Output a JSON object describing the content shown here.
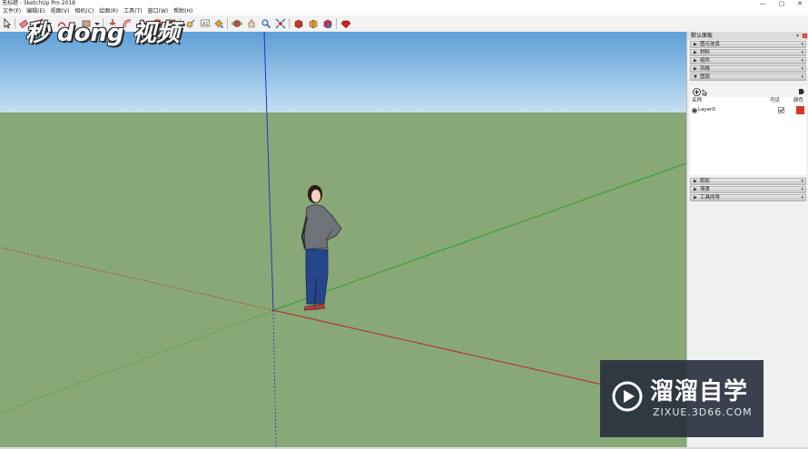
{
  "window": {
    "title": "无标题 - SketchUp Pro 2018",
    "minimize": "—",
    "maximize": "▢",
    "close": "✕"
  },
  "menu": [
    "文件(F)",
    "编辑(E)",
    "视图(V)",
    "相机(C)",
    "绘图(R)",
    "工具(T)",
    "窗口(W)",
    "帮助(H)"
  ],
  "toolbar": {
    "tools": [
      "select-tool",
      "eraser-tool",
      "line-tool",
      "arc-tool",
      "rectangle-tool",
      "push-pull-tool",
      "move-tool",
      "rotate-tool",
      "scale-tool",
      "offset-tool",
      "tape-measure-tool",
      "text-tool",
      "paint-bucket-tool",
      "orbit-tool",
      "pan-tool",
      "zoom-tool",
      "zoom-extents-tool",
      "warehouse-tool",
      "extension-tool",
      "component-tool",
      "ruby-tool"
    ]
  },
  "tray": {
    "title": "默认面板",
    "pin": "▾",
    "close": "✕",
    "panels_top": [
      {
        "label": "图元信息",
        "expanded": false
      },
      {
        "label": "材料",
        "expanded": false
      },
      {
        "label": "组件",
        "expanded": false
      },
      {
        "label": "风格",
        "expanded": false
      },
      {
        "label": "图层",
        "expanded": true
      }
    ],
    "layers": {
      "col_name": "名称",
      "col_visible": "可见",
      "col_color": "颜色",
      "rows": [
        {
          "name": "Layer0",
          "active": true,
          "visible": true,
          "color": "#d9362b"
        }
      ]
    },
    "panels_bottom": [
      {
        "label": "阴影"
      },
      {
        "label": "场景"
      },
      {
        "label": "工具向导"
      }
    ]
  },
  "overlays": {
    "logo_text": "秒 dong 视频",
    "watermark_main": "溜溜自学",
    "watermark_sub": "ZIXUE.3D66.COM"
  },
  "colors": {
    "sky_top": "#5d9fd8",
    "sky_bottom": "#c6dff0",
    "ground": "#89a877",
    "axis_red": "#b5282a",
    "axis_green": "#2f9a2f",
    "axis_blue": "#2632c8",
    "layer_color": "#d9362b"
  }
}
